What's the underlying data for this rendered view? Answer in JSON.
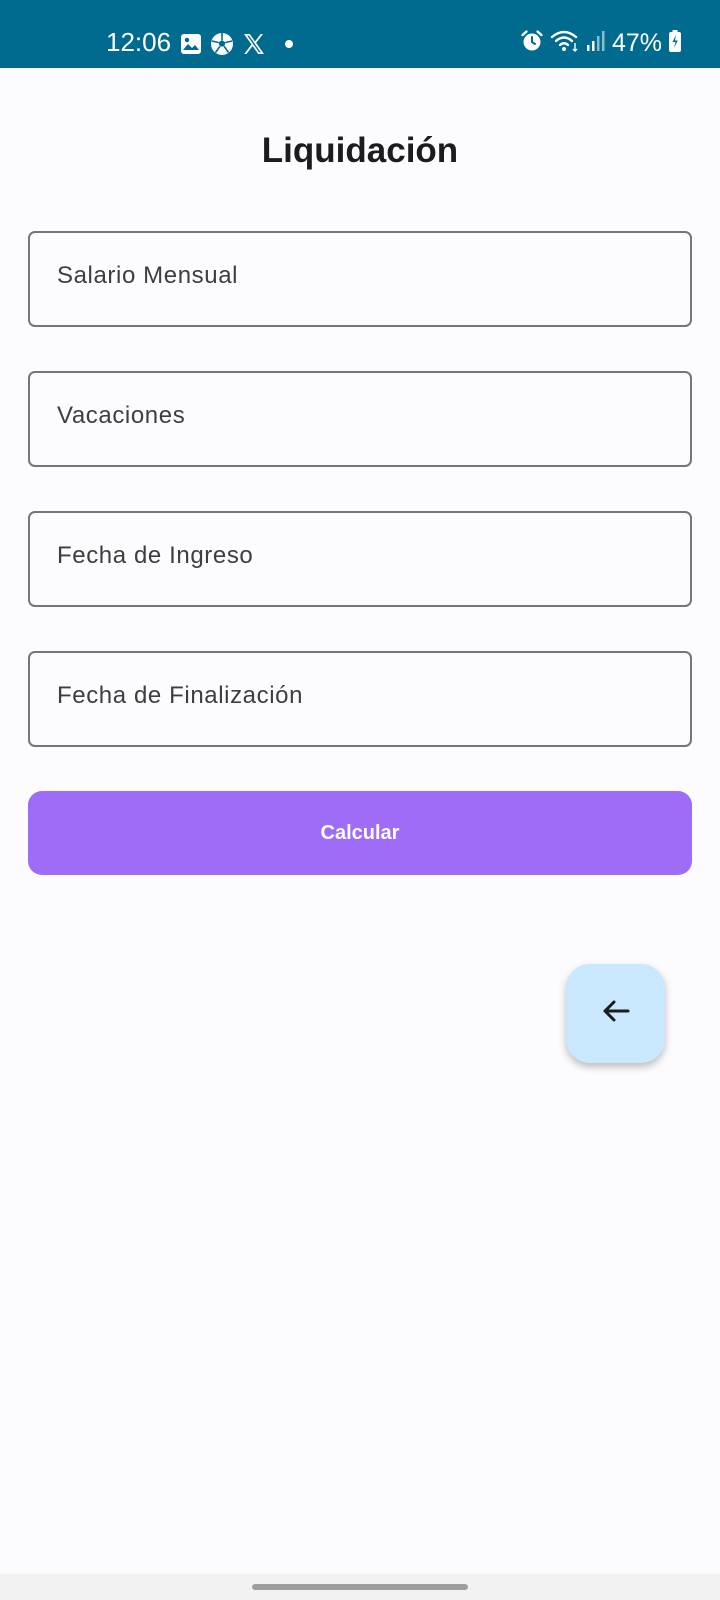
{
  "status_bar": {
    "time": "12:06",
    "battery": "47%",
    "left_icons": [
      "gallery-icon",
      "soccer-ball-icon",
      "x-logo-icon",
      "notification-dot-icon"
    ],
    "right_icons": [
      "alarm-icon",
      "wifi-icon",
      "signal-icon",
      "battery-icon"
    ],
    "background": "#006a8f"
  },
  "page": {
    "title": "Liquidación"
  },
  "form": {
    "fields": [
      {
        "label": "Salario Mensual"
      },
      {
        "label": "Vacaciones"
      },
      {
        "label": "Fecha de Ingreso"
      },
      {
        "label": "Fecha de Finalización"
      }
    ],
    "submit_label": "Calcular",
    "submit_color": "#9e6cf6"
  },
  "fab": {
    "icon": "arrow-back-icon",
    "background": "#c9e8fd"
  }
}
